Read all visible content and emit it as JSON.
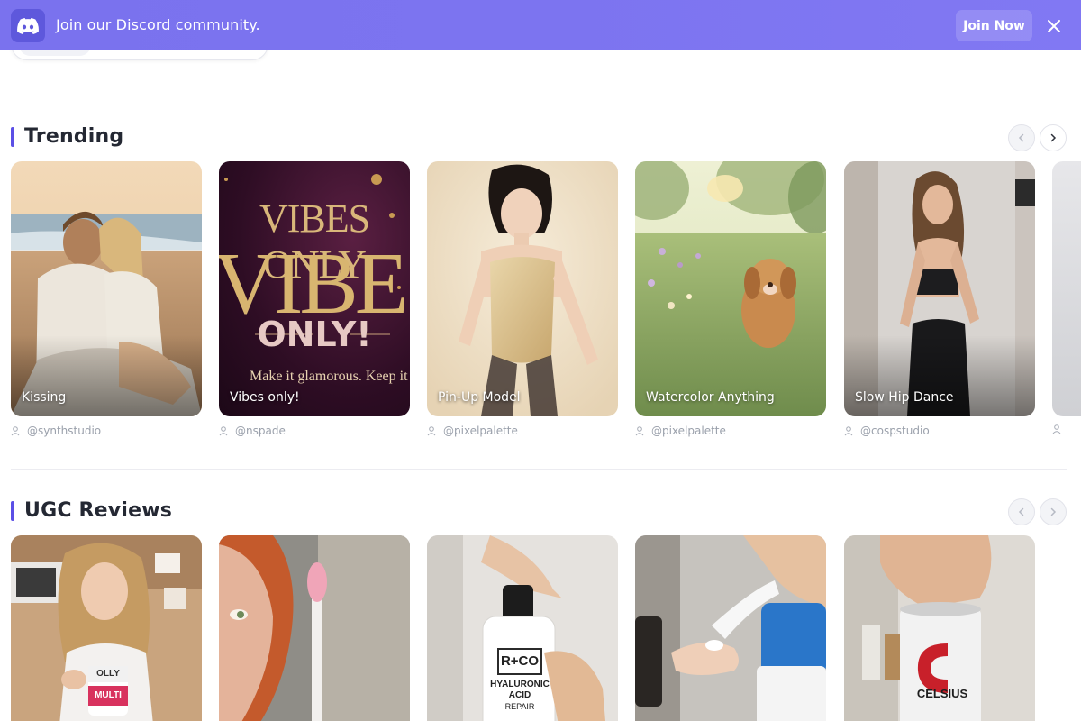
{
  "banner": {
    "text": "Join our Discord community.",
    "join_label": "Join Now",
    "icons": {
      "logo": "discord-icon",
      "close": "close-icon"
    },
    "colors": {
      "bg": "#7a72ee",
      "badge": "#5e58dc"
    }
  },
  "sections": [
    {
      "title": "Trending",
      "cards": [
        {
          "label": "Kissing",
          "author": "@synthstudio"
        },
        {
          "label": "Vibes only!",
          "author": "@nspade"
        },
        {
          "label": "Pin-Up Model",
          "author": "@pixelpalette"
        },
        {
          "label": "Watercolor Anything",
          "author": "@pixelpalette"
        },
        {
          "label": "Slow Hip Dance",
          "author": "@cospstudio"
        }
      ]
    },
    {
      "title": "UGC Reviews",
      "cards": []
    }
  ],
  "vibes_art": {
    "line1": "VIBES ONLY",
    "big": "VIBES",
    "only": "ONLY!",
    "sub": "Make it glamorous. Keep it ele"
  },
  "stickers": {
    "rco": "R+CO",
    "hyaluronic": "HYALURONIC",
    "acid": "ACID",
    "repair": "REPAIR",
    "celsius": "CELSIUS",
    "olly": "OLLY",
    "multi": "MULTI"
  },
  "accent_color": "#5b4fe6"
}
